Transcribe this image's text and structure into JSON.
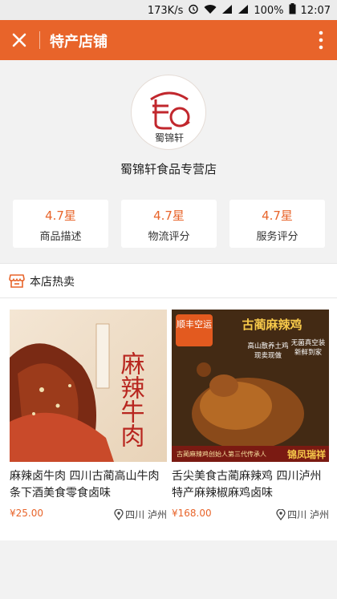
{
  "status_bar": {
    "speed": "173K/s",
    "battery": "100%",
    "time": "12:07"
  },
  "titlebar": {
    "title": "特产店铺",
    "close_icon": "close-icon",
    "more_icon": "more-vertical-icon"
  },
  "shop": {
    "logo_text": "蜀锦轩",
    "name": "蜀锦轩食品专营店"
  },
  "ratings": [
    {
      "value": "4.7星",
      "label": "商品描述"
    },
    {
      "value": "4.7星",
      "label": "物流评分"
    },
    {
      "value": "4.7星",
      "label": "服务评分"
    }
  ],
  "hot": {
    "label": "本店热卖",
    "icon": "shop-icon"
  },
  "products": [
    {
      "title": "麻辣卤牛肉 四川古蔺高山牛肉条下酒美食零食卤味",
      "price": "¥25.00",
      "location": "四川 泸州",
      "image_text": "麻辣牛肉"
    },
    {
      "title": "舌尖美食古蔺麻辣鸡 四川泸州特产麻辣椒麻鸡卤味",
      "price": "¥168.00",
      "location": "四川 泸州",
      "image_badge": "顺丰空运",
      "image_heading": "古蔺麻辣鸡",
      "image_tags": [
        "高山散养土鸡",
        "无菌真空装",
        "现卖现做",
        "新鲜到家"
      ],
      "image_footer_small": "古蔺麻辣鸡创始人第三代传承人",
      "image_footer_brand": "锦凤瑞祥"
    }
  ],
  "colors": {
    "accent": "#e8642a",
    "background": "#f2f2f2"
  }
}
